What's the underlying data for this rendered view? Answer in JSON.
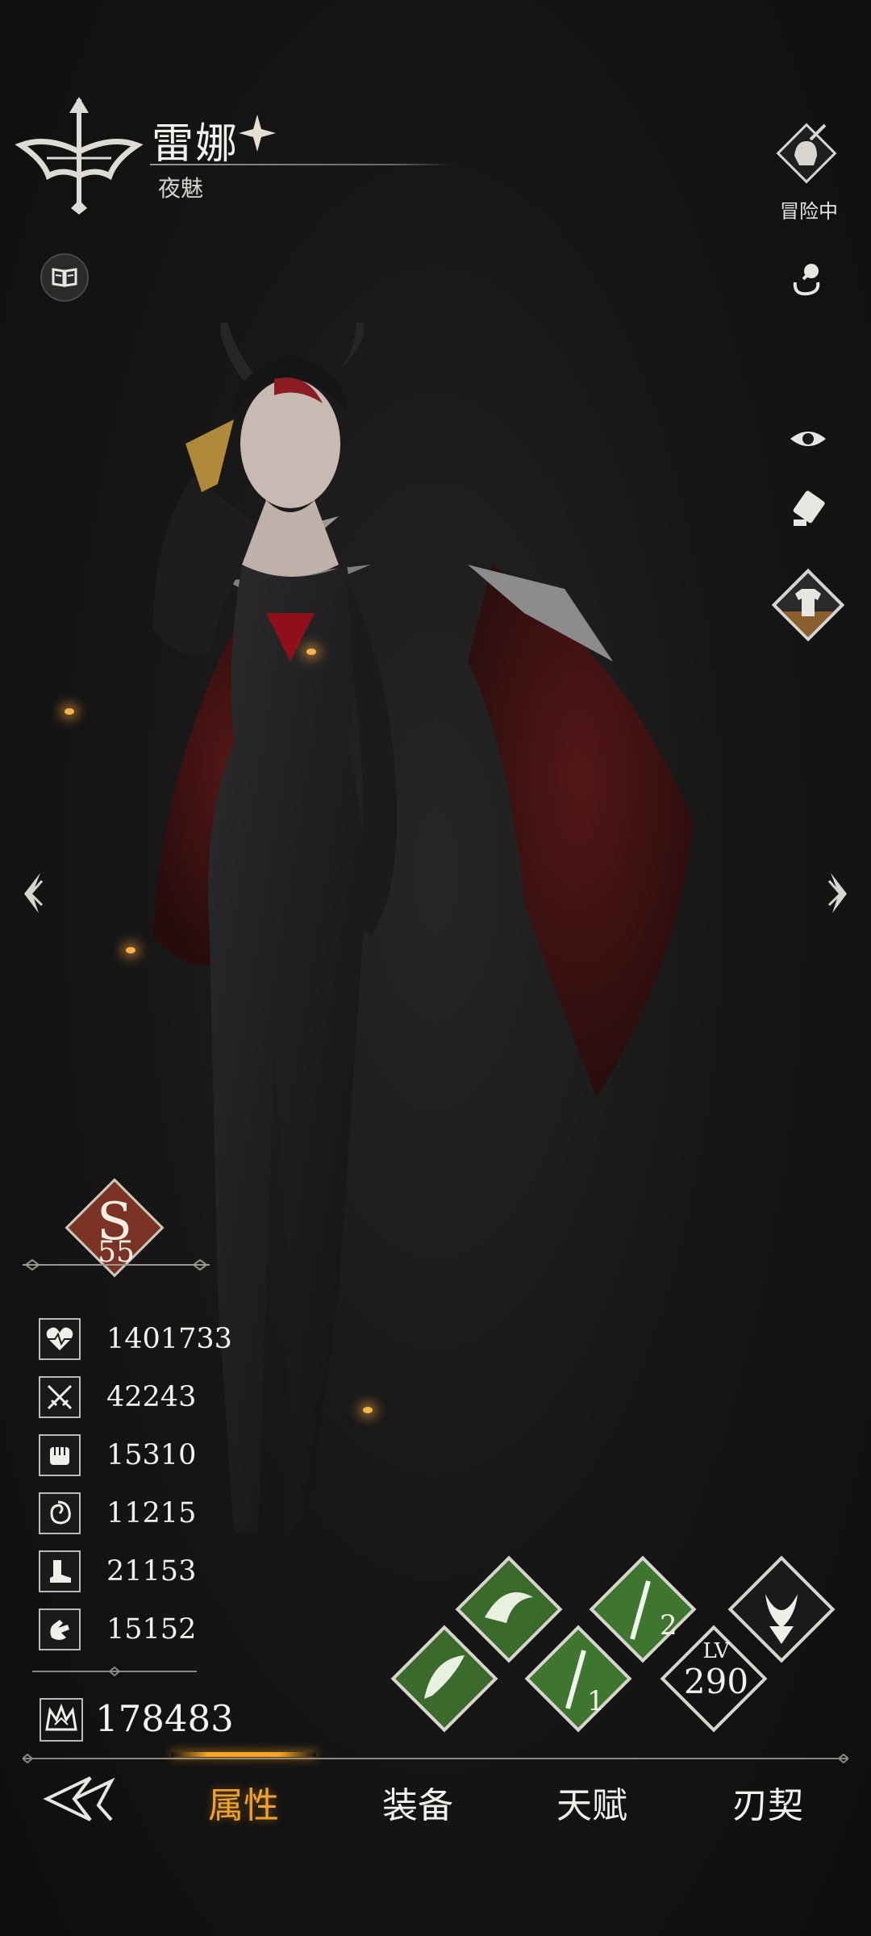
{
  "header": {
    "name": "雷娜",
    "subtitle": "夜魅"
  },
  "sidebar_right": {
    "adventure_label": "冒险中"
  },
  "rank": {
    "letter": "S",
    "level": "55",
    "color": "#7a3324"
  },
  "stats": [
    {
      "icon": "heart-icon",
      "value": "1401733"
    },
    {
      "icon": "crossed-swords-icon",
      "value": "42243"
    },
    {
      "icon": "fist-icon",
      "value": "15310"
    },
    {
      "icon": "vortex-icon",
      "value": "11215"
    },
    {
      "icon": "boot-icon",
      "value": "21153"
    },
    {
      "icon": "hand-icon",
      "value": "15152"
    }
  ],
  "power": {
    "icon": "crown-emblem-icon",
    "value": "178483"
  },
  "skills": {
    "skill_1_label": "1",
    "skill_2_label": "2",
    "level_label": "LV",
    "level_value": "290"
  },
  "nav": {
    "tabs": [
      "属性",
      "装备",
      "天赋",
      "刃契"
    ],
    "active_index": 0,
    "active_color": "#f2a327"
  }
}
